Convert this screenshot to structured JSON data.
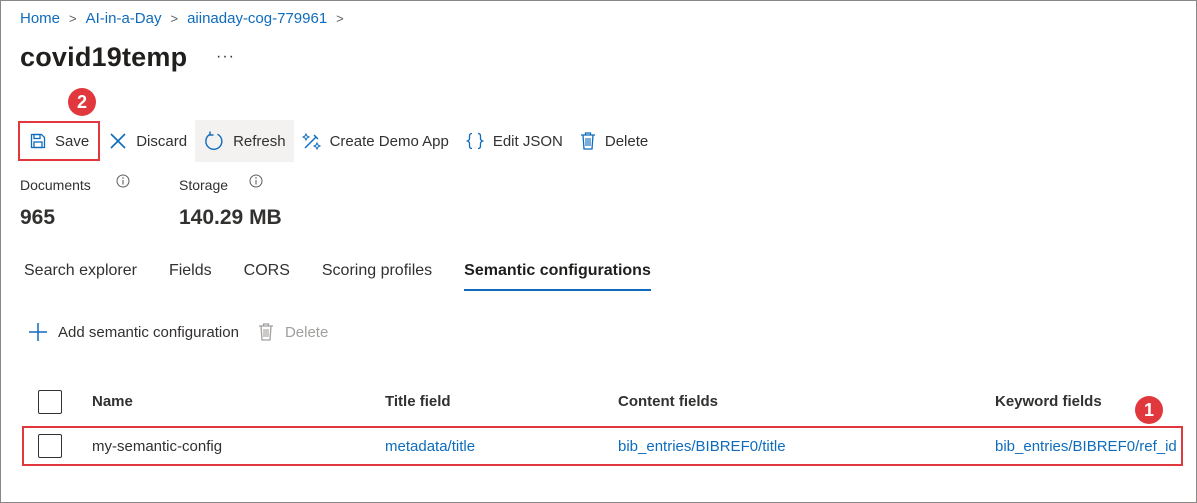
{
  "breadcrumb": {
    "items": [
      "Home",
      "AI-in-a-Day",
      "aiinaday-cog-779961"
    ],
    "separator": ">"
  },
  "page": {
    "title": "covid19temp",
    "more_label": "···"
  },
  "toolbar": {
    "save_label": "Save",
    "discard_label": "Discard",
    "refresh_label": "Refresh",
    "create_demo_label": "Create Demo App",
    "edit_json_label": "Edit JSON",
    "delete_label": "Delete"
  },
  "callouts": {
    "save_step": "2",
    "row_step": "1",
    "color": "#e0383d"
  },
  "stats": {
    "documents_label": "Documents",
    "documents_value": "965",
    "storage_label": "Storage",
    "storage_value": "140.29 MB"
  },
  "tabs": [
    {
      "label": "Search explorer",
      "active": false
    },
    {
      "label": "Fields",
      "active": false
    },
    {
      "label": "CORS",
      "active": false
    },
    {
      "label": "Scoring profiles",
      "active": false
    },
    {
      "label": "Semantic configurations",
      "active": true
    }
  ],
  "semantic_toolbar": {
    "add_label": "Add semantic configuration",
    "delete_label": "Delete"
  },
  "table": {
    "columns": [
      "Name",
      "Title field",
      "Content fields",
      "Keyword fields"
    ],
    "rows": [
      {
        "name": "my-semantic-config",
        "title_field": "metadata/title",
        "content_fields": "bib_entries/BIBREF0/title",
        "keyword_fields": "bib_entries/BIBREF0/ref_id"
      }
    ]
  },
  "colors": {
    "accent": "#0f6cbd",
    "highlight": "#e0383d"
  }
}
